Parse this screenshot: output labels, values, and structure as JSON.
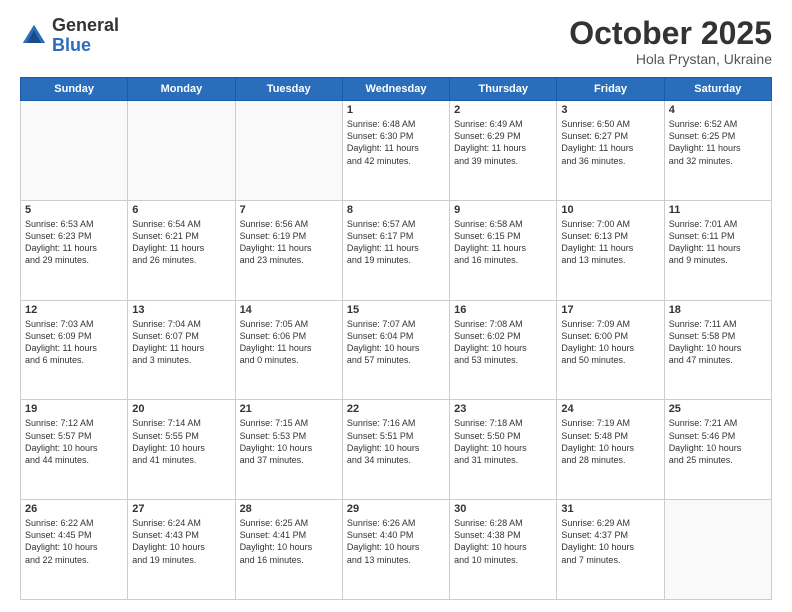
{
  "logo": {
    "general": "General",
    "blue": "Blue"
  },
  "header": {
    "month": "October 2025",
    "location": "Hola Prystan, Ukraine"
  },
  "weekdays": [
    "Sunday",
    "Monday",
    "Tuesday",
    "Wednesday",
    "Thursday",
    "Friday",
    "Saturday"
  ],
  "weeks": [
    [
      {
        "day": "",
        "info": ""
      },
      {
        "day": "",
        "info": ""
      },
      {
        "day": "",
        "info": ""
      },
      {
        "day": "1",
        "info": "Sunrise: 6:48 AM\nSunset: 6:30 PM\nDaylight: 11 hours\nand 42 minutes."
      },
      {
        "day": "2",
        "info": "Sunrise: 6:49 AM\nSunset: 6:29 PM\nDaylight: 11 hours\nand 39 minutes."
      },
      {
        "day": "3",
        "info": "Sunrise: 6:50 AM\nSunset: 6:27 PM\nDaylight: 11 hours\nand 36 minutes."
      },
      {
        "day": "4",
        "info": "Sunrise: 6:52 AM\nSunset: 6:25 PM\nDaylight: 11 hours\nand 32 minutes."
      }
    ],
    [
      {
        "day": "5",
        "info": "Sunrise: 6:53 AM\nSunset: 6:23 PM\nDaylight: 11 hours\nand 29 minutes."
      },
      {
        "day": "6",
        "info": "Sunrise: 6:54 AM\nSunset: 6:21 PM\nDaylight: 11 hours\nand 26 minutes."
      },
      {
        "day": "7",
        "info": "Sunrise: 6:56 AM\nSunset: 6:19 PM\nDaylight: 11 hours\nand 23 minutes."
      },
      {
        "day": "8",
        "info": "Sunrise: 6:57 AM\nSunset: 6:17 PM\nDaylight: 11 hours\nand 19 minutes."
      },
      {
        "day": "9",
        "info": "Sunrise: 6:58 AM\nSunset: 6:15 PM\nDaylight: 11 hours\nand 16 minutes."
      },
      {
        "day": "10",
        "info": "Sunrise: 7:00 AM\nSunset: 6:13 PM\nDaylight: 11 hours\nand 13 minutes."
      },
      {
        "day": "11",
        "info": "Sunrise: 7:01 AM\nSunset: 6:11 PM\nDaylight: 11 hours\nand 9 minutes."
      }
    ],
    [
      {
        "day": "12",
        "info": "Sunrise: 7:03 AM\nSunset: 6:09 PM\nDaylight: 11 hours\nand 6 minutes."
      },
      {
        "day": "13",
        "info": "Sunrise: 7:04 AM\nSunset: 6:07 PM\nDaylight: 11 hours\nand 3 minutes."
      },
      {
        "day": "14",
        "info": "Sunrise: 7:05 AM\nSunset: 6:06 PM\nDaylight: 11 hours\nand 0 minutes."
      },
      {
        "day": "15",
        "info": "Sunrise: 7:07 AM\nSunset: 6:04 PM\nDaylight: 10 hours\nand 57 minutes."
      },
      {
        "day": "16",
        "info": "Sunrise: 7:08 AM\nSunset: 6:02 PM\nDaylight: 10 hours\nand 53 minutes."
      },
      {
        "day": "17",
        "info": "Sunrise: 7:09 AM\nSunset: 6:00 PM\nDaylight: 10 hours\nand 50 minutes."
      },
      {
        "day": "18",
        "info": "Sunrise: 7:11 AM\nSunset: 5:58 PM\nDaylight: 10 hours\nand 47 minutes."
      }
    ],
    [
      {
        "day": "19",
        "info": "Sunrise: 7:12 AM\nSunset: 5:57 PM\nDaylight: 10 hours\nand 44 minutes."
      },
      {
        "day": "20",
        "info": "Sunrise: 7:14 AM\nSunset: 5:55 PM\nDaylight: 10 hours\nand 41 minutes."
      },
      {
        "day": "21",
        "info": "Sunrise: 7:15 AM\nSunset: 5:53 PM\nDaylight: 10 hours\nand 37 minutes."
      },
      {
        "day": "22",
        "info": "Sunrise: 7:16 AM\nSunset: 5:51 PM\nDaylight: 10 hours\nand 34 minutes."
      },
      {
        "day": "23",
        "info": "Sunrise: 7:18 AM\nSunset: 5:50 PM\nDaylight: 10 hours\nand 31 minutes."
      },
      {
        "day": "24",
        "info": "Sunrise: 7:19 AM\nSunset: 5:48 PM\nDaylight: 10 hours\nand 28 minutes."
      },
      {
        "day": "25",
        "info": "Sunrise: 7:21 AM\nSunset: 5:46 PM\nDaylight: 10 hours\nand 25 minutes."
      }
    ],
    [
      {
        "day": "26",
        "info": "Sunrise: 6:22 AM\nSunset: 4:45 PM\nDaylight: 10 hours\nand 22 minutes."
      },
      {
        "day": "27",
        "info": "Sunrise: 6:24 AM\nSunset: 4:43 PM\nDaylight: 10 hours\nand 19 minutes."
      },
      {
        "day": "28",
        "info": "Sunrise: 6:25 AM\nSunset: 4:41 PM\nDaylight: 10 hours\nand 16 minutes."
      },
      {
        "day": "29",
        "info": "Sunrise: 6:26 AM\nSunset: 4:40 PM\nDaylight: 10 hours\nand 13 minutes."
      },
      {
        "day": "30",
        "info": "Sunrise: 6:28 AM\nSunset: 4:38 PM\nDaylight: 10 hours\nand 10 minutes."
      },
      {
        "day": "31",
        "info": "Sunrise: 6:29 AM\nSunset: 4:37 PM\nDaylight: 10 hours\nand 7 minutes."
      },
      {
        "day": "",
        "info": ""
      }
    ]
  ]
}
